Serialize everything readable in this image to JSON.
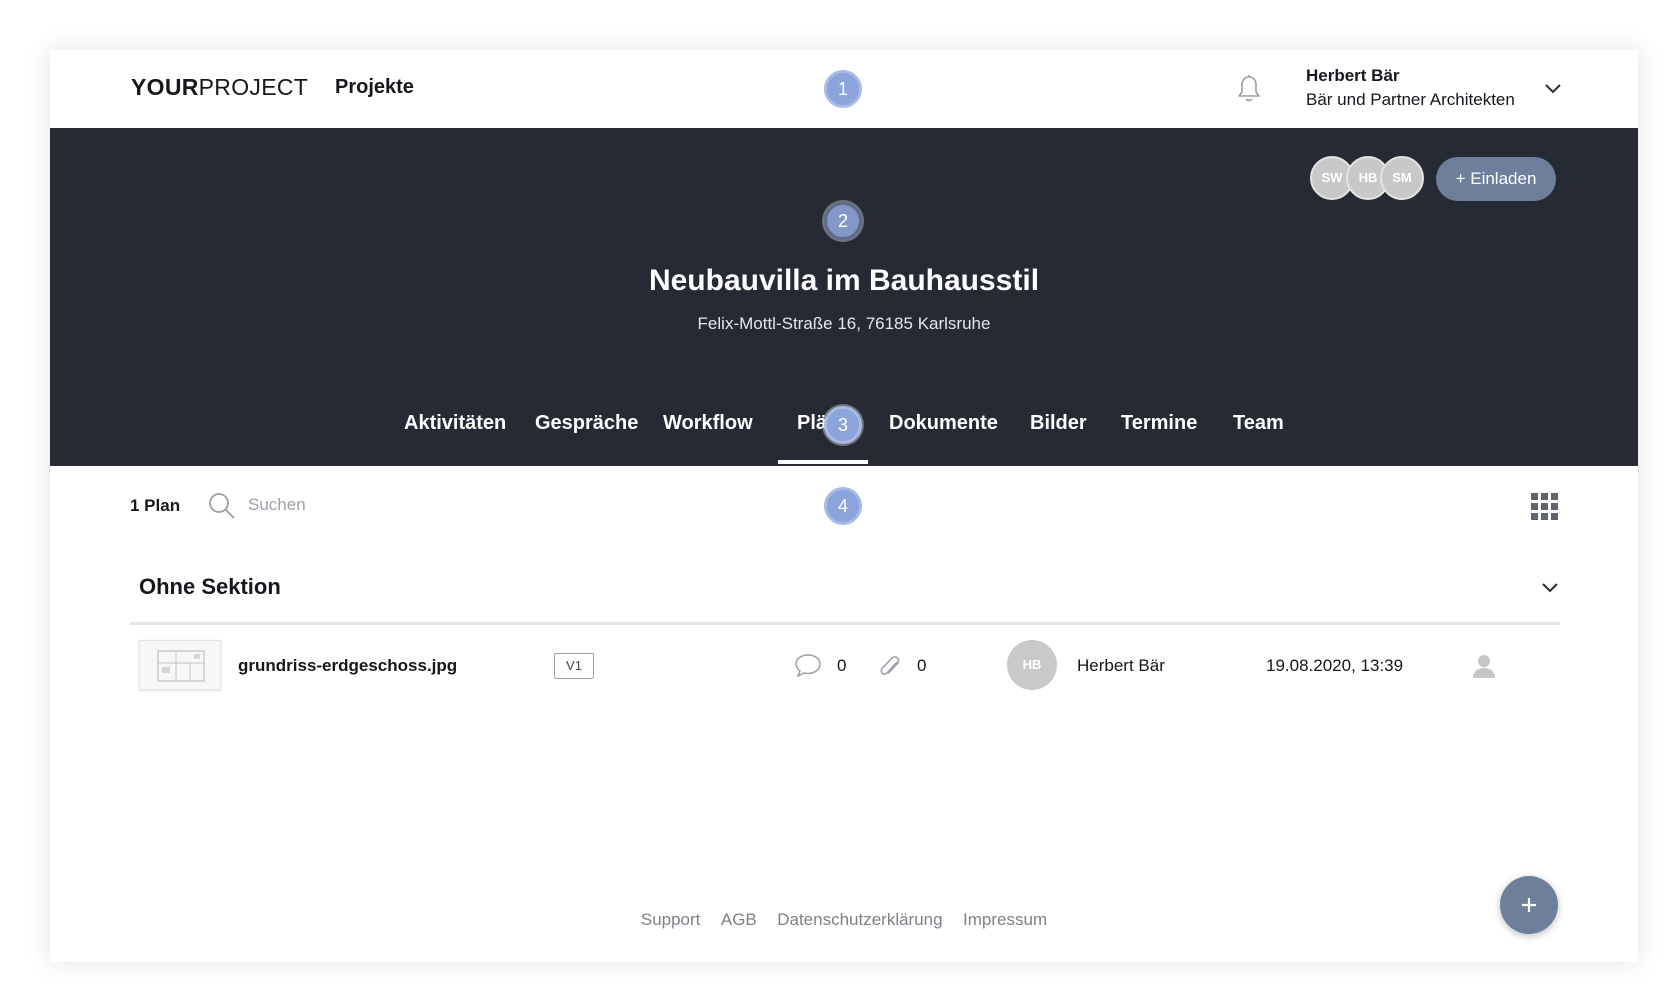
{
  "colors": {
    "hero_bg": "#252a35",
    "accent_button": "#6d7f9b",
    "step_marker": "#8ba4dc",
    "avatar_bg": "#c9c9c9"
  },
  "header": {
    "logo_bold": "YOUR",
    "logo_thin": "PROJECT",
    "nav_projects": "Projekte",
    "bell_icon": "bell-icon",
    "user": {
      "name": "Herbert Bär",
      "company": "Bär und Partner Architekten"
    }
  },
  "steps": [
    "1",
    "2",
    "3",
    "4"
  ],
  "project": {
    "members": [
      "SW",
      "HB",
      "SM"
    ],
    "invite_label": "+ Einladen",
    "title": "Neubauvilla im Bauhausstil",
    "address": "Felix-Mottl-Straße 16, 76185 Karlsruhe",
    "tabs": [
      {
        "label": "Aktivitäten"
      },
      {
        "label": "Gespräche"
      },
      {
        "label": "Workflow"
      },
      {
        "label": "Pläne",
        "active": true
      },
      {
        "label": "Dokumente"
      },
      {
        "label": "Bilder"
      },
      {
        "label": "Termine"
      },
      {
        "label": "Team"
      }
    ],
    "tab_visible_labels": [
      "Aktivitäten",
      "Gespräche",
      "Workflow",
      "Plä",
      "Dokumente",
      "Bilder",
      "Termine",
      "Team"
    ]
  },
  "toolbar": {
    "count_label": "1 Plan",
    "search_placeholder": "Suchen"
  },
  "section": {
    "title": "Ohne Sektion",
    "rows": [
      {
        "file_name": "grundriss-erdgeschoss.jpg",
        "version": "V1",
        "comments": "0",
        "attachments": "0",
        "author_initials": "HB",
        "author": "Herbert Bär",
        "date": "19.08.2020, 13:39"
      }
    ]
  },
  "footer": {
    "links": [
      "Support",
      "AGB",
      "Datenschutzerklärung",
      "Impressum"
    ]
  },
  "fab_label": "+"
}
